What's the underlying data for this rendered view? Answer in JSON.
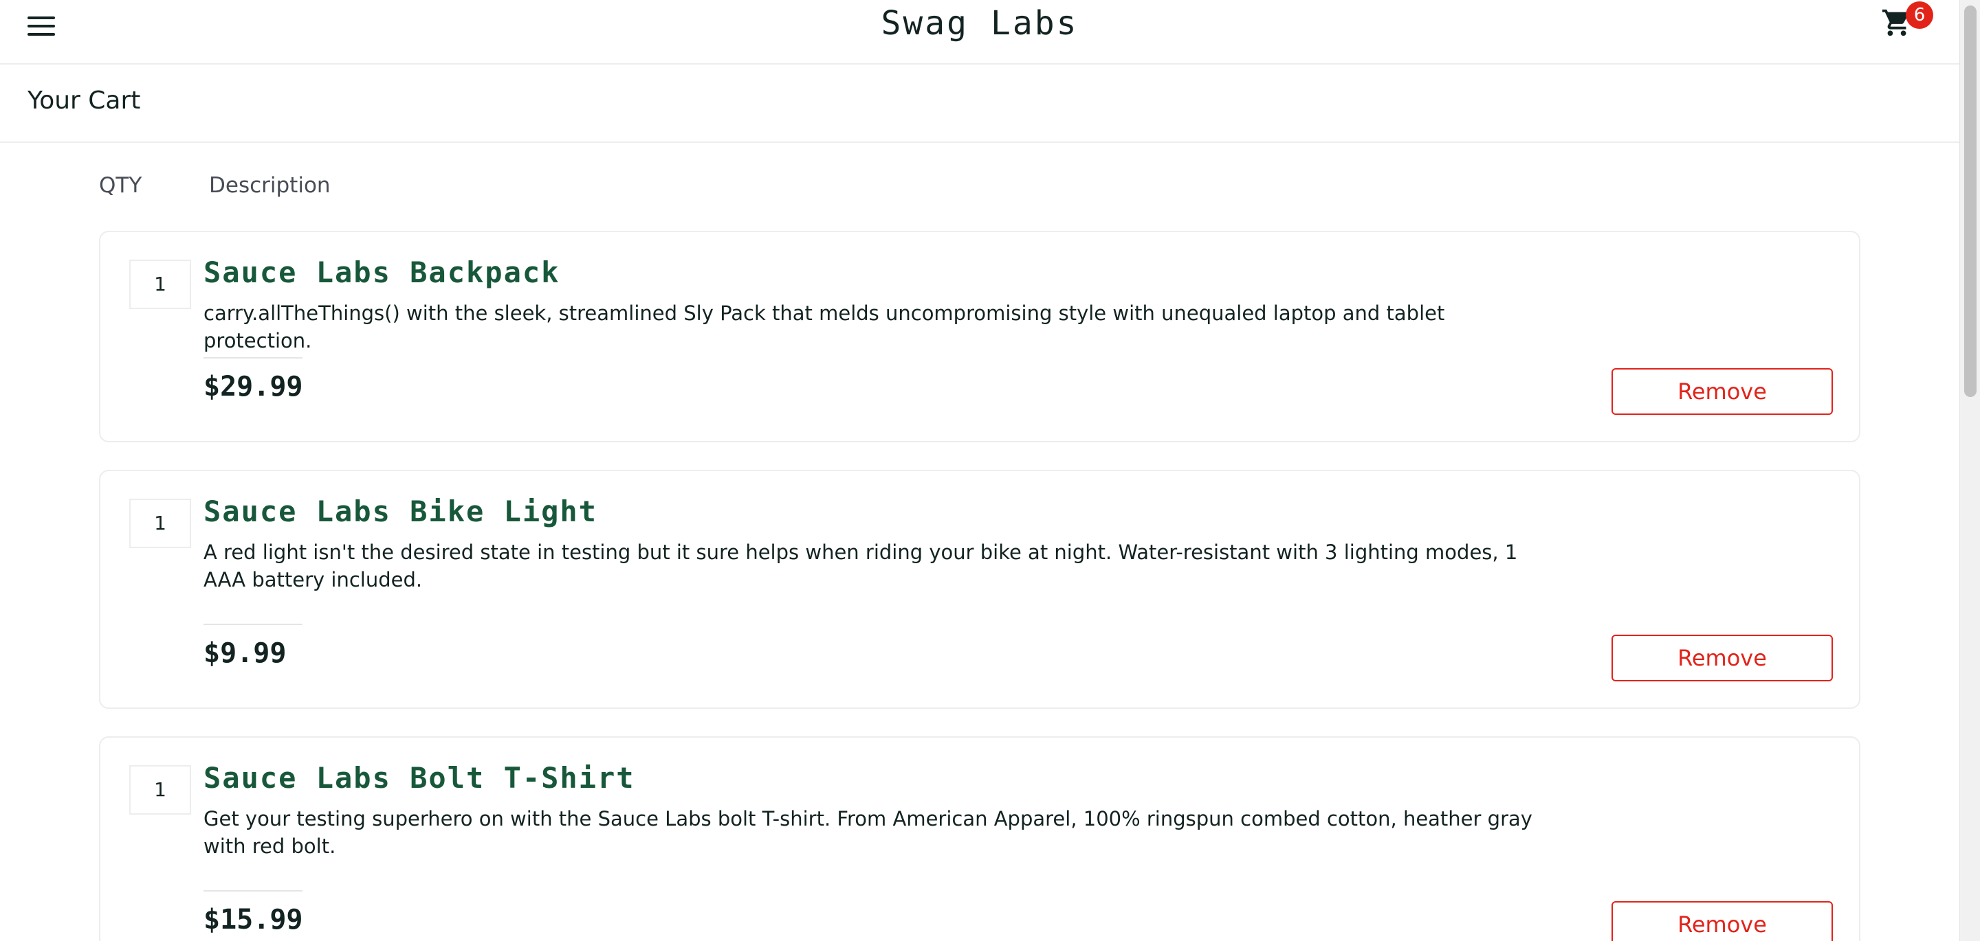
{
  "header": {
    "logo": "Swag Labs",
    "cart_badge": "6",
    "menu_icon": "hamburger-menu-icon",
    "cart_icon": "shopping-cart-icon"
  },
  "secondary_header": {
    "title": "Your Cart"
  },
  "cart_list": {
    "qty_label": "QTY",
    "desc_label": "Description",
    "items": [
      {
        "qty": "1",
        "name": "Sauce Labs Backpack",
        "description": "carry.allTheThings() with the sleek, streamlined Sly Pack that melds uncompromising style with unequaled laptop and tablet protection.",
        "price": "$29.99",
        "remove_label": "Remove"
      },
      {
        "qty": "1",
        "name": "Sauce Labs Bike Light",
        "description": "A red light isn't the desired state in testing but it sure helps when riding your bike at night. Water-resistant with 3 lighting modes, 1 AAA battery included.",
        "price": "$9.99",
        "remove_label": "Remove"
      },
      {
        "qty": "1",
        "name": "Sauce Labs Bolt T-Shirt",
        "description": "Get your testing superhero on with the Sauce Labs bolt T-shirt. From American Apparel, 100% ringspun combed cotton, heather gray with red bolt.",
        "price": "$15.99",
        "remove_label": "Remove"
      }
    ]
  },
  "colors": {
    "brand_green": "#18583a",
    "danger_red": "#e2231a",
    "text_dark": "#132322",
    "border_light": "#ededed"
  }
}
